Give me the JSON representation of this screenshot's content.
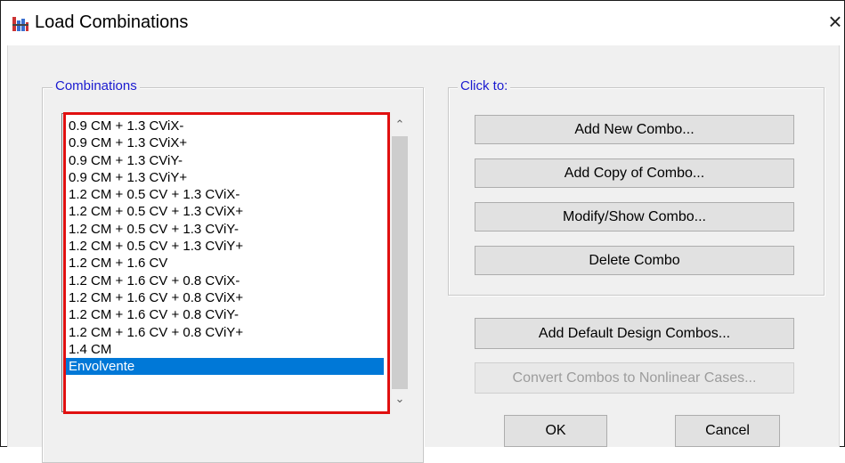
{
  "window": {
    "title": "Load Combinations",
    "close_symbol": "×"
  },
  "combinations_group": {
    "label": "Combinations",
    "items": [
      "0.9 CM + 1.3 CViX-",
      "0.9 CM + 1.3 CViX+",
      "0.9 CM + 1.3 CViY-",
      "0.9 CM + 1.3 CViY+",
      "1.2 CM + 0.5 CV + 1.3 CViX-",
      "1.2 CM + 0.5 CV + 1.3 CViX+",
      "1.2 CM + 0.5 CV + 1.3 CViY-",
      "1.2 CM + 0.5 CV + 1.3 CViY+",
      "1.2 CM + 1.6 CV",
      "1.2 CM + 1.6 CV + 0.8 CViX-",
      "1.2 CM + 1.6 CV + 0.8 CViX+",
      "1.2 CM + 1.6 CV + 0.8 CViY-",
      "1.2 CM + 1.6 CV + 0.8 CViY+",
      "1.4 CM",
      "Envolvente"
    ],
    "selected_index": 14
  },
  "click_to_group": {
    "label": "Click to:",
    "add_new": "Add New Combo...",
    "add_copy": "Add Copy of Combo...",
    "modify_show": "Modify/Show Combo...",
    "delete": "Delete Combo"
  },
  "actions": {
    "add_default": "Add Default Design Combos...",
    "convert": "Convert Combos to Nonlinear Cases..."
  },
  "footer": {
    "ok": "OK",
    "cancel": "Cancel"
  },
  "colors": {
    "selection": "#0078d7",
    "highlight_border": "#e01010",
    "group_label": "#1a1ad0"
  }
}
